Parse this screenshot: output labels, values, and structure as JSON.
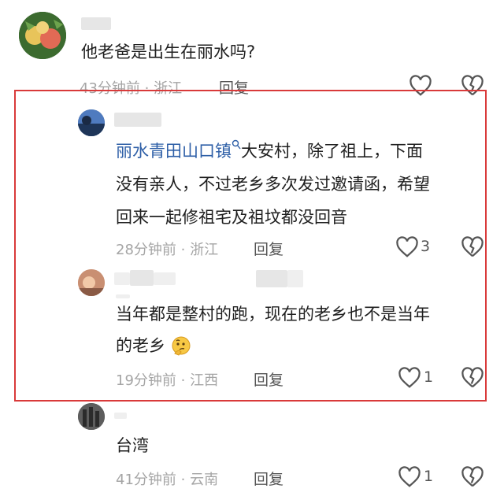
{
  "comments": [
    {
      "id": "c1",
      "text": "他老爸是出生在丽水吗?",
      "meta": "43分钟前 · 浙江",
      "reply_label": "回复",
      "like_count": ""
    },
    {
      "id": "c2",
      "link_text": "丽水青田山口镇",
      "text_line1_rest": "大安村，除了祖上，下面",
      "text_line2": "没有亲人，不过老乡多次发过邀请函，希望",
      "text_line3": "回来一起修祖宅及祖坟都没回音",
      "meta": "28分钟前 · 浙江",
      "reply_label": "回复",
      "like_count": "3"
    },
    {
      "id": "c3",
      "text_line1": "当年都是整村的跑，现在的老乡也不是当年",
      "text_line2": "的老乡",
      "emoji": "thinking-face-emoji",
      "meta": "19分钟前 · 江西",
      "reply_label": "回复",
      "like_count": "1"
    },
    {
      "id": "c4",
      "text": "台湾",
      "meta": "41分钟前 · 云南",
      "reply_label": "回复",
      "like_count": "1"
    }
  ],
  "colors": {
    "highlight_border": "#d93a3a",
    "link": "#2e5fa7",
    "meta": "#a5a5a5"
  }
}
